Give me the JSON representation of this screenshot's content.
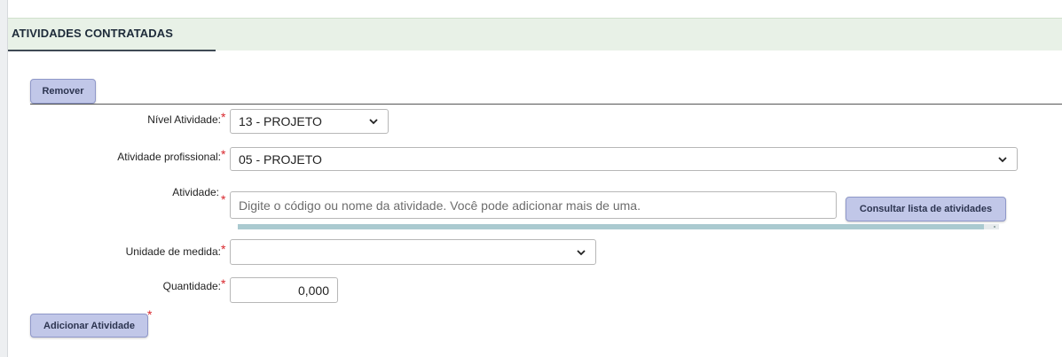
{
  "section": {
    "title": "ATIVIDADES CONTRATADAS"
  },
  "buttons": {
    "remove": "Remover",
    "consult": "Consultar lista de atividades",
    "add": "Adicionar Atividade"
  },
  "required_mark": "*",
  "fields": {
    "nivel": {
      "label": "Nível Atividade:",
      "value": "13 - PROJETO"
    },
    "profissional": {
      "label": "Atividade profissional:",
      "value": "05 - PROJETO"
    },
    "atividade": {
      "label": "Atividade:",
      "placeholder": "Digite o código ou nome da atividade. Você pode adicionar mais de uma.",
      "value": ""
    },
    "unidade": {
      "label": "Unidade de medida:",
      "value": ""
    },
    "quantidade": {
      "label": "Quantidade:",
      "value": "0,000"
    }
  },
  "progress": {
    "fraction": 0.98
  },
  "colors": {
    "header_bg": "#e8f1e7",
    "button_bg": "#c1c7e8",
    "required": "#d8262c"
  },
  "icons": {
    "dropdown": "chevron-down-icon"
  }
}
